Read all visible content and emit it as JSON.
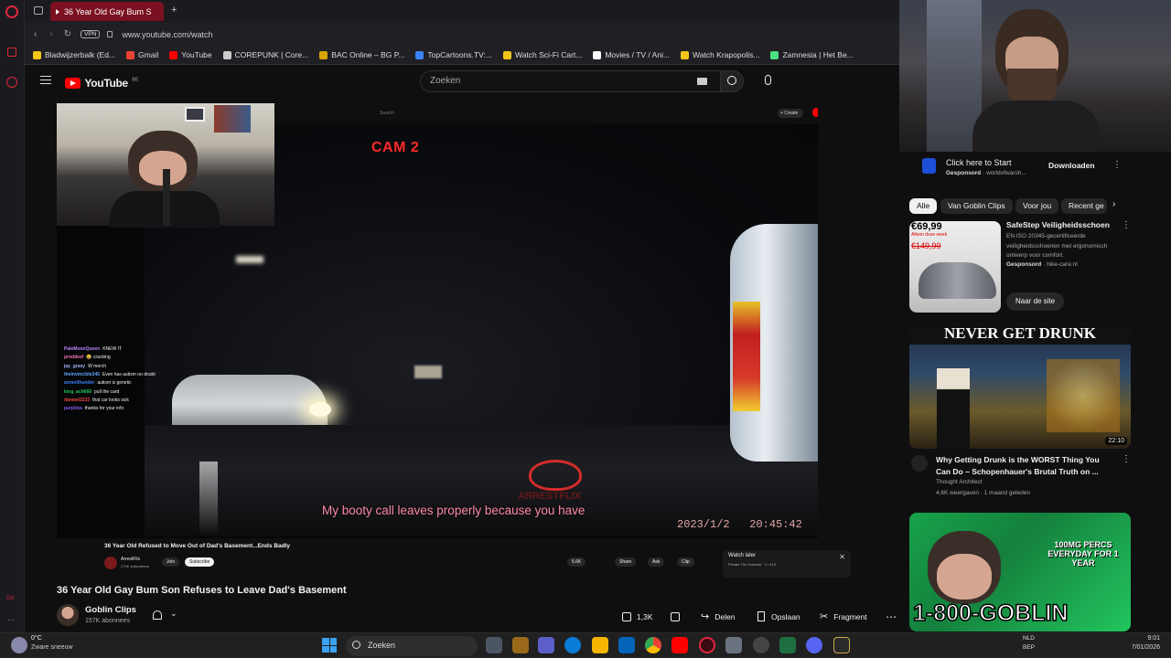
{
  "browser": {
    "tab_title": "36 Year Old Gay Bum S",
    "tab_plus": "+",
    "vpn_badge": "VPN",
    "url": "www.youtube.com/watch",
    "bookmarks": [
      "Bladwijzerbalk (Ed...",
      "Gmail",
      "YouTube",
      "COREPUNK | Core...",
      "BAC Online – BG P...",
      "TopCartoons.TV:...",
      "Watch Sci-Fi Cart...",
      "Movies / TV / Ani...",
      "Watch Krapopolis...",
      "Zamnesia | Het Be..."
    ],
    "bookmark_colors": [
      "#f5c518",
      "#ea4335",
      "#ff0000",
      "#cccccc",
      "#d6a500",
      "#3b82f6",
      "#f5c518",
      "#ffffff",
      "#f5c518",
      "#4ade80"
    ]
  },
  "youtube": {
    "logo_text": "YouTube",
    "logo_region": "BE",
    "search_placeholder": "Zoeken"
  },
  "stream_overlay": {
    "search_mini": "Search",
    "create_label": "+ Create",
    "cam_label": "CAM 2",
    "subtitle": "My booty call leaves properly because you have",
    "timestamp": "2023/1/2   20:45:42",
    "watermark": "ARRESTFLIX",
    "chat": [
      {
        "user": "PaleMoonQueen",
        "msg": "KNEW IT",
        "color": "#c084fc"
      },
      {
        "user": "proddeef",
        "msg": "😂 cracking",
        "color": "#f472b6"
      },
      {
        "user": "jay_gravy",
        "msg": "W merch",
        "color": "#a5b4fc"
      },
      {
        "user": "theinvincible345",
        "msg": "Even has autism no doubt",
        "color": "#60a5fa"
      },
      {
        "user": "anmolthunder",
        "msg": "autism is genetic",
        "color": "#3b82f6"
      },
      {
        "user": "king_ach666",
        "msg": "pull the card",
        "color": "#22c55e"
      },
      {
        "user": "danwel2233",
        "msg": "that car looks sick",
        "color": "#ef4444"
      },
      {
        "user": "purplina",
        "msg": "thanks for your info",
        "color": "#8b5cf6"
      }
    ],
    "inner_title": "36 Year Old Refused to Move Out of Dad's Basement...Ends Badly",
    "inner_channel": "ArrestFlix",
    "inner_subs": "270K subscribers",
    "inner_join": "Join",
    "inner_subscribe": "Subscribe",
    "inner_likes": "5.6K",
    "inner_share": "Share",
    "inner_ask": "Ask",
    "inner_clip": "Clip",
    "watch_later_title": "Watch later",
    "watch_later_sub": "Private  The Dobcast · 1 / 415"
  },
  "video": {
    "title": "36 Year Old Gay Bum Son Refuses to Leave Dad's Basement",
    "channel": "Goblin Clips",
    "subscribers": "157K abonnees",
    "likes": "1,3K",
    "share": "Delen",
    "save": "Opslaan",
    "clip": "Fragment"
  },
  "sidebar": {
    "ad1": {
      "title": "Click here to Start",
      "sponsored": "Gesponsord",
      "domain": "worldofwarsh...",
      "button": "Downloaden"
    },
    "chips": [
      "Alle",
      "Van Goblin Clips",
      "Voor jou",
      "Recent ge"
    ],
    "ad2": {
      "title": "SafeStep Veiligheidsschoen",
      "desc": "EN ISO 20345-gecertificeerde veiligheidsschoenen met ergonomisch ontwerp voor comfort.",
      "sponsored": "Gesponsord",
      "domain": "hike-care.nl",
      "button": "Naar de site",
      "price_new": "€69,99",
      "price_old": "€149,99",
      "promo": "Alleen deze week"
    },
    "video1": {
      "thumb_text": "NEVER GET DRUNK",
      "duration": "22:10",
      "title": "Why Getting Drunk is the WORST Thing You Can Do – Schopenhauer's Brutal Truth on ...",
      "channel": "Thought Architect",
      "meta": "4,6K weergaven · 1 maand geleden"
    },
    "video2": {
      "thumb_text_top": "100MG PERCS EVERYDAY FOR 1 YEAR",
      "thumb_text_bottom": "1-800-GOBLIN"
    }
  },
  "taskbar": {
    "temp": "0°C",
    "weather": "Zware sneeuw",
    "search": "Zoeken",
    "lang1": "NLD",
    "lang2": "BEP",
    "time": "9:01",
    "date": "7/01/2026"
  }
}
